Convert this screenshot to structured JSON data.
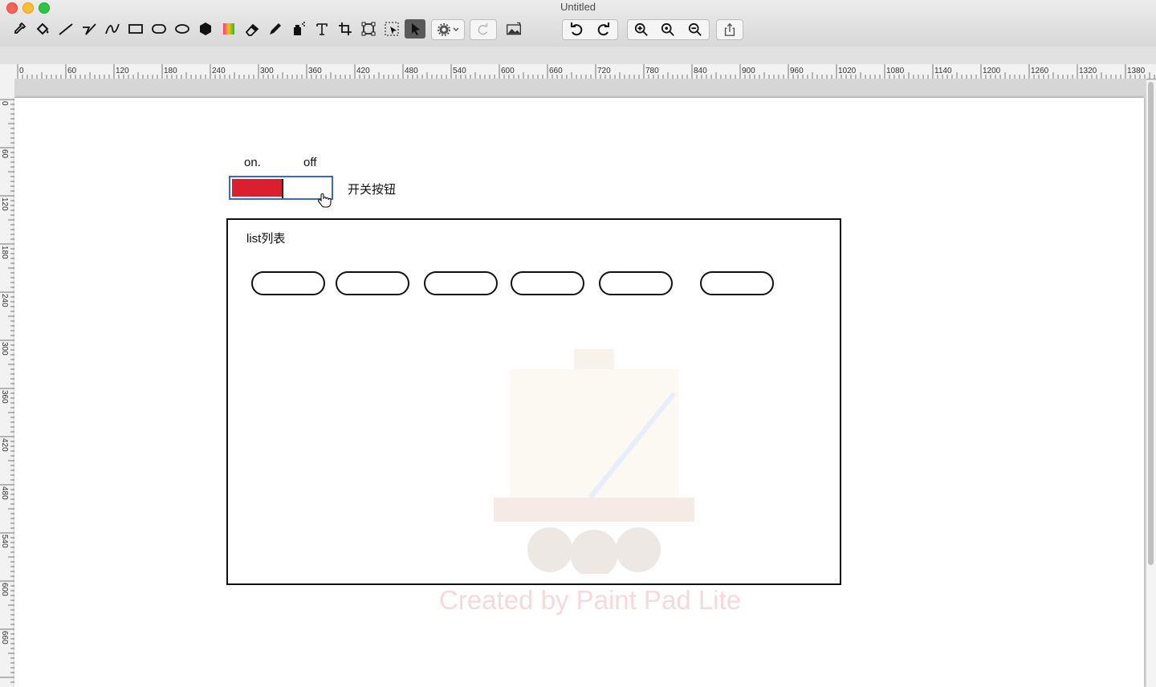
{
  "window": {
    "title": "Untitled"
  },
  "toolbar": {
    "tools": [
      "eyedropper-icon",
      "paint-bucket-icon",
      "line-icon",
      "polyline-icon",
      "curve-icon",
      "rectangle-icon",
      "rounded-rectangle-icon",
      "ellipse-icon",
      "polygon-icon",
      "gradient-icon",
      "eraser-icon",
      "pencil-icon",
      "spray-icon",
      "text-icon",
      "crop-icon",
      "transform-icon",
      "magic-select-icon",
      "pointer-icon"
    ],
    "settings": "gear-icon",
    "redo_disabled": "redo-icon",
    "image": "image-icon",
    "undo": "undo-icon",
    "redo": "redo-icon",
    "zoom_in": "zoom-in-icon",
    "zoom_actual": "zoom-actual-icon",
    "zoom_out": "zoom-out-icon",
    "share": "share-icon"
  },
  "ruler": {
    "h_ticks": [
      "0",
      "60",
      "120",
      "180",
      "240",
      "300",
      "360",
      "420",
      "480",
      "540",
      "600",
      "660",
      "720",
      "780",
      "840",
      "900",
      "960",
      "1020",
      "1080",
      "1140",
      "1200",
      "1260",
      "1320",
      "1380"
    ],
    "v_ticks": [
      "0",
      "60",
      "120",
      "180",
      "240",
      "300",
      "360",
      "420",
      "480",
      "540",
      "600",
      "660"
    ]
  },
  "canvas": {
    "switch_on_label": "on.",
    "switch_off_label": "off",
    "switch_caption": "开关按钮",
    "list_title": "list列表",
    "watermark": "Created by Paint Pad Lite"
  },
  "colors": {
    "switch_on": "#dc1f2e",
    "switch_border": "#3a69c9",
    "watermark": "#f6d9dc"
  }
}
